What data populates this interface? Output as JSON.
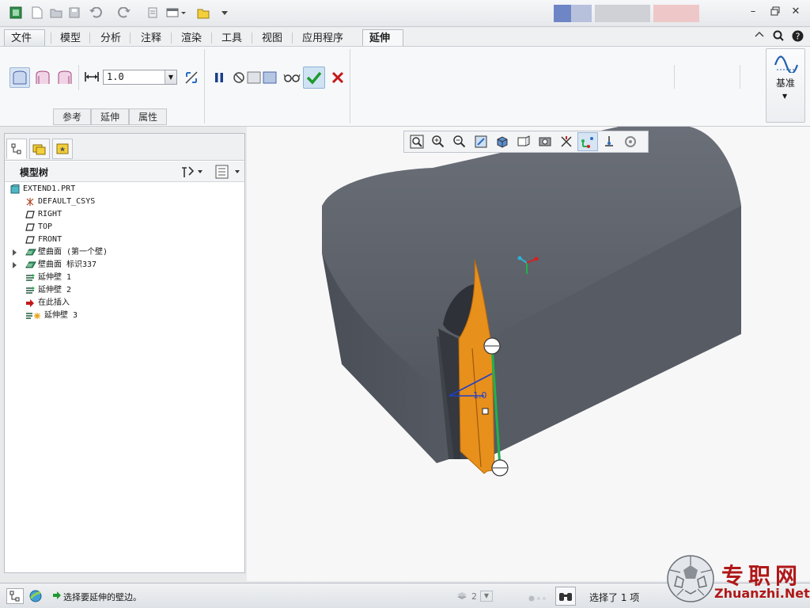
{
  "ribbon": {
    "tabs": [
      "文件",
      "模型",
      "分析",
      "注释",
      "渲染",
      "工具",
      "视图",
      "应用程序",
      "延伸"
    ],
    "active_tab": "延伸",
    "extend_distance_value": "1.0",
    "subtabs": [
      "参考",
      "延伸",
      "属性"
    ],
    "datum_group_label": "基准"
  },
  "model_tree": {
    "header_title": "模型树",
    "items": [
      {
        "label": "EXTEND1.PRT",
        "icon": "part-icon",
        "indent": 0,
        "expandable": false
      },
      {
        "label": "DEFAULT_CSYS",
        "icon": "csys-icon",
        "indent": 1,
        "expandable": false
      },
      {
        "label": "RIGHT",
        "icon": "datum-plane-icon",
        "indent": 1,
        "expandable": false
      },
      {
        "label": "TOP",
        "icon": "datum-plane-icon",
        "indent": 1,
        "expandable": false
      },
      {
        "label": "FRONT",
        "icon": "datum-plane-icon",
        "indent": 1,
        "expandable": false
      },
      {
        "label": "壁曲面 (第一个壁)",
        "icon": "sheetmetal-wall-icon",
        "indent": 1,
        "expandable": true
      },
      {
        "label": "壁曲面 标识337",
        "icon": "sheetmetal-wall-icon",
        "indent": 1,
        "expandable": true
      },
      {
        "label": "延伸壁 1",
        "icon": "extend-wall-icon",
        "indent": 1,
        "expandable": false
      },
      {
        "label": "延伸壁 2",
        "icon": "extend-wall-icon",
        "indent": 1,
        "expandable": false
      },
      {
        "label": "在此插入",
        "icon": "insert-arrow-icon",
        "indent": 1,
        "expandable": false
      },
      {
        "label": "延伸壁 3",
        "icon": "extend-wall-new-icon",
        "indent": 1,
        "expandable": false
      }
    ]
  },
  "viewport": {
    "dimension_label": "1.0"
  },
  "status": {
    "message": "选择要延伸的壁边。",
    "filter_value": "2",
    "selection_text": "选择了 1 项"
  },
  "watermark": {
    "cn": "专职网",
    "en": "Zhuanzhi.Net"
  },
  "colors": {
    "accent": "#2c6fc4",
    "ok_check": "#1e9a2e",
    "cancel_x": "#c41818",
    "extend_surface": "#e8901c",
    "model_gray": "#5c6068"
  }
}
